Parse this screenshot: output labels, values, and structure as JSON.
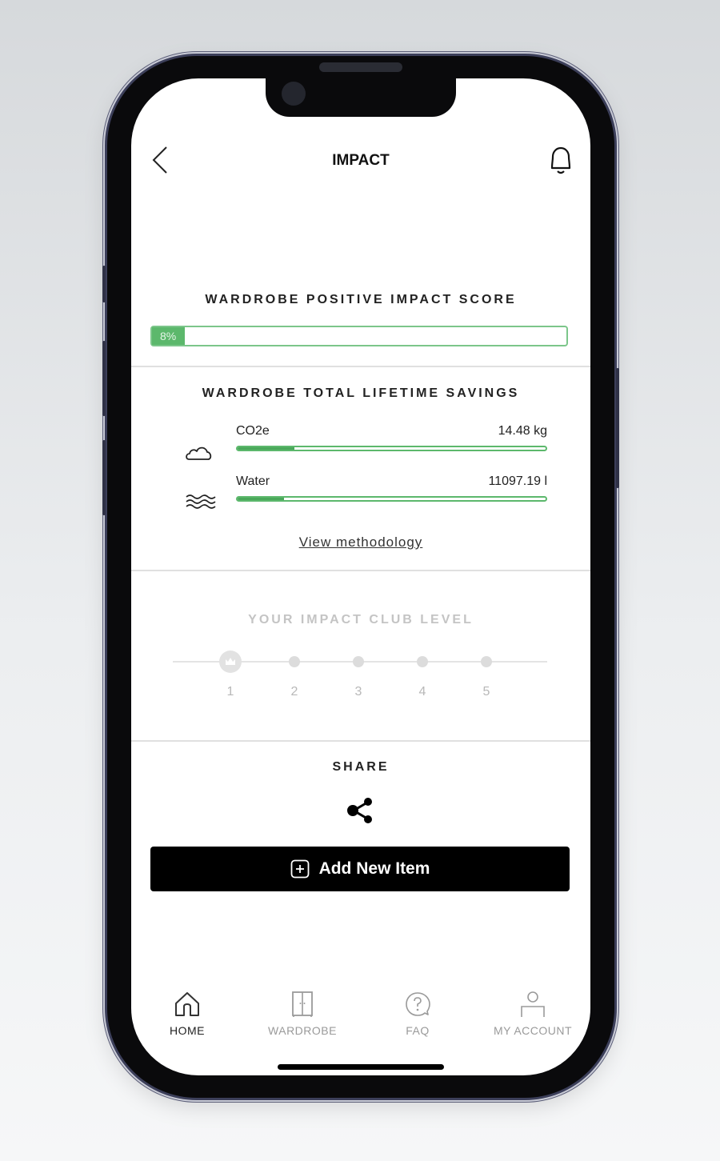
{
  "header": {
    "title": "IMPACT",
    "back_icon": "chevron-left-icon",
    "notification_icon": "bell-icon"
  },
  "score": {
    "title": "WARDROBE POSITIVE IMPACT SCORE",
    "value_label": "8%",
    "value_percent": 8,
    "color": "#5cb86c"
  },
  "savings": {
    "title": "WARDROBE TOTAL LIFETIME SAVINGS",
    "metrics": [
      {
        "icon": "cloud-icon",
        "name": "CO2e",
        "value": "14.48 kg",
        "fill_percent": 18.5
      },
      {
        "icon": "water-waves-icon",
        "name": "Water",
        "value": "11097.19 l",
        "fill_percent": 15
      }
    ],
    "methodology_link": "View methodology"
  },
  "club": {
    "title": "YOUR IMPACT CLUB LEVEL",
    "levels": [
      "1",
      "2",
      "3",
      "4",
      "5"
    ],
    "current_level": 1,
    "current_icon": "crown-icon"
  },
  "share": {
    "title": "SHARE",
    "icon": "share-icon"
  },
  "add_button": {
    "label": "Add New Item",
    "icon": "plus-square-icon"
  },
  "nav": {
    "items": [
      {
        "label": "HOME",
        "icon": "home-icon",
        "active": true
      },
      {
        "label": "WARDROBE",
        "icon": "wardrobe-icon",
        "active": false
      },
      {
        "label": "FAQ",
        "icon": "faq-icon",
        "active": false
      },
      {
        "label": "MY ACCOUNT",
        "icon": "account-icon",
        "active": false
      }
    ]
  }
}
